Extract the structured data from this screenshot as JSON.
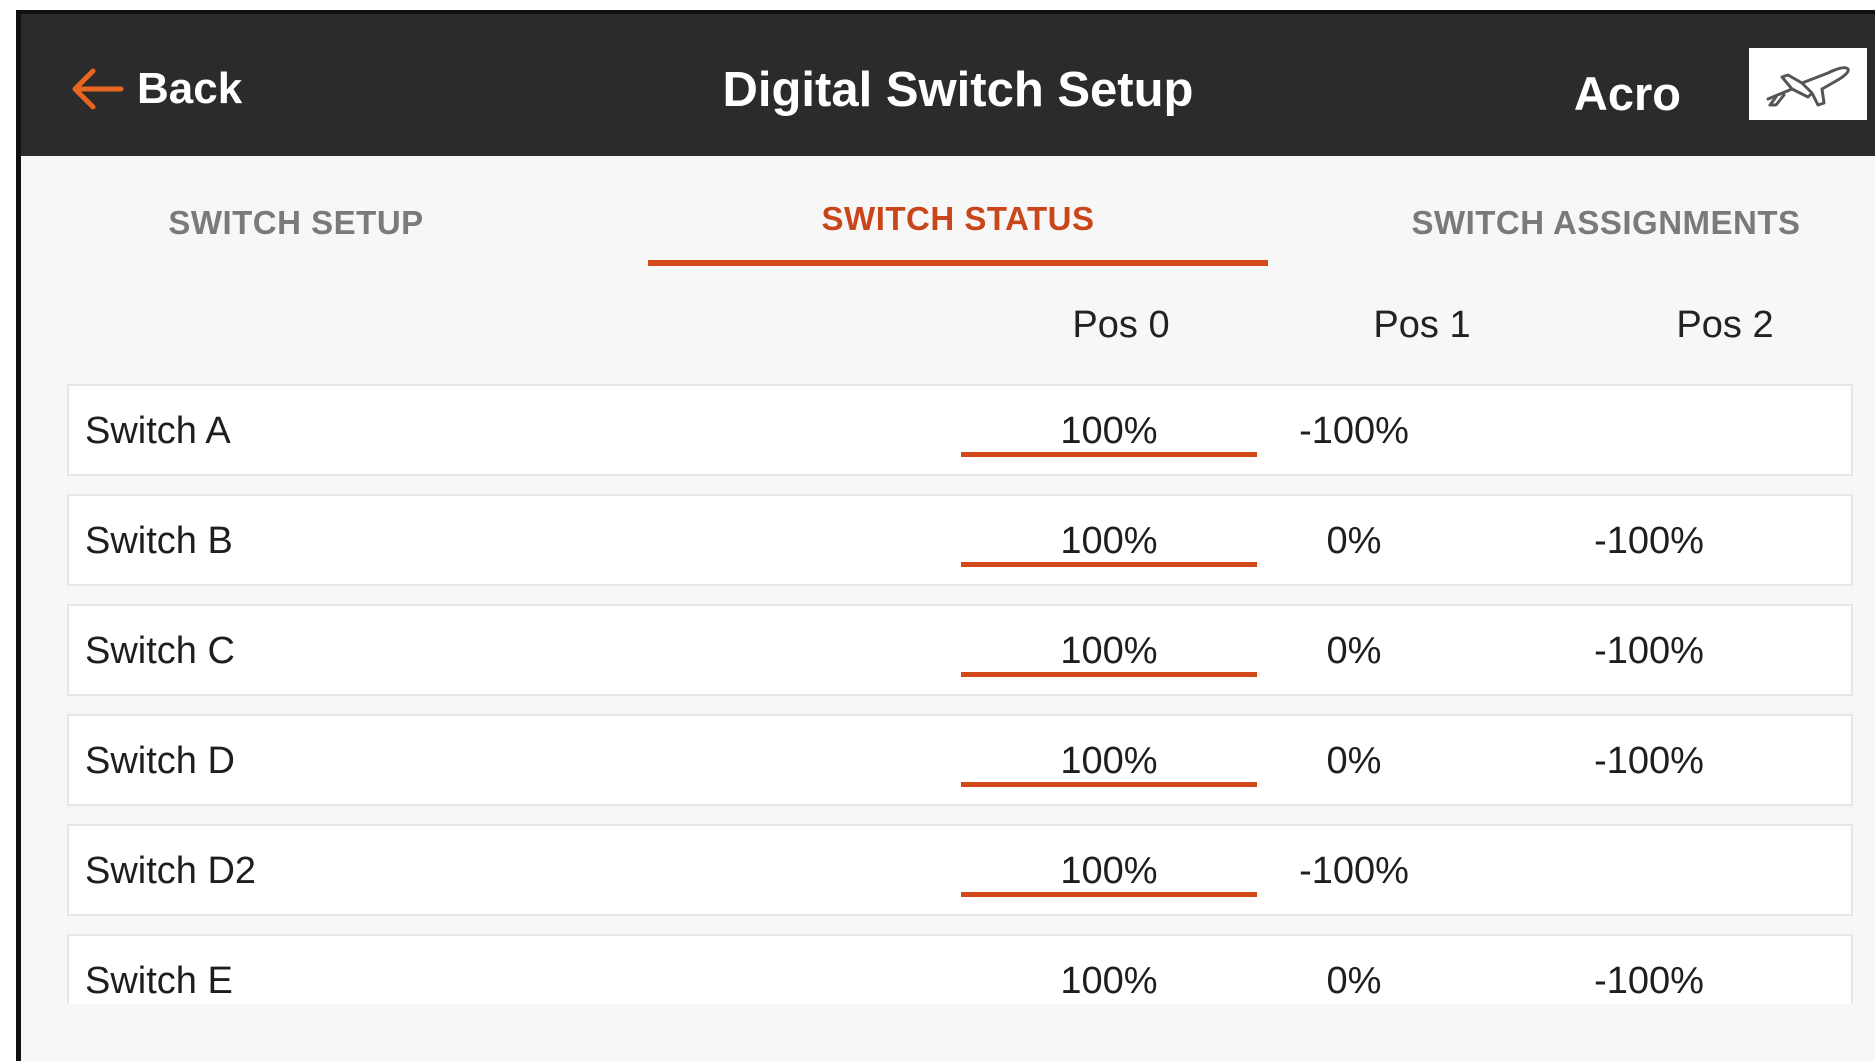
{
  "header": {
    "back_label": "Back",
    "title": "Digital Switch Setup",
    "model_name": "Acro",
    "model_icon": "airplane-icon",
    "back_icon": "arrow-left-icon"
  },
  "tabs": [
    {
      "label": "SWITCH SETUP",
      "active": false
    },
    {
      "label": "SWITCH STATUS",
      "active": true
    },
    {
      "label": "SWITCH ASSIGNMENTS",
      "active": false
    }
  ],
  "columns": [
    "Pos 0",
    "Pos 1",
    "Pos 2"
  ],
  "rows": [
    {
      "name": "Switch A",
      "pos0": "100%",
      "pos1": "-100%",
      "pos2": "",
      "active_position": 0
    },
    {
      "name": "Switch B",
      "pos0": "100%",
      "pos1": "0%",
      "pos2": "-100%",
      "active_position": 0
    },
    {
      "name": "Switch C",
      "pos0": "100%",
      "pos1": "0%",
      "pos2": "-100%",
      "active_position": 0
    },
    {
      "name": "Switch D",
      "pos0": "100%",
      "pos1": "0%",
      "pos2": "-100%",
      "active_position": 0
    },
    {
      "name": "Switch D2",
      "pos0": "100%",
      "pos1": "-100%",
      "pos2": "",
      "active_position": 0
    },
    {
      "name": "Switch E",
      "pos0": "100%",
      "pos1": "0%",
      "pos2": "-100%",
      "active_position": 0
    }
  ],
  "colors": {
    "accent": "#d24a18",
    "header_bg": "#2b2b2b",
    "active_tab": "#c9461a",
    "inactive_tab": "#7a7a7a"
  }
}
